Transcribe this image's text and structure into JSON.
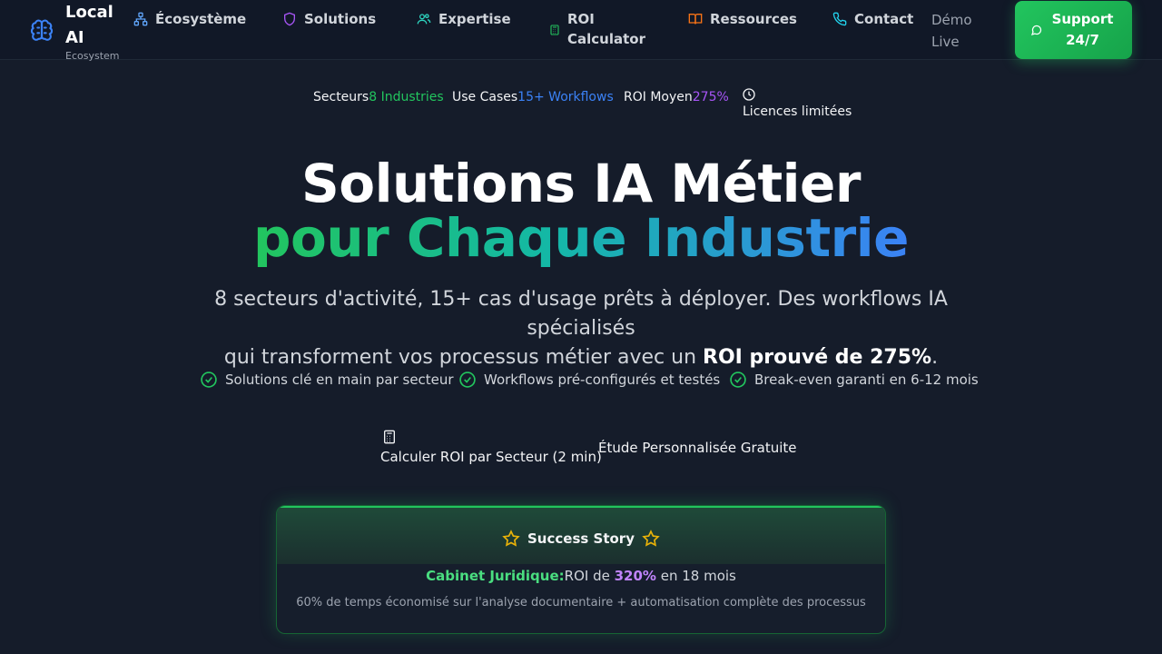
{
  "brand": {
    "name": "Local AI",
    "subtitle": "Ecosystem"
  },
  "nav": {
    "items": [
      {
        "label": "Écosystème",
        "icon": "network-icon",
        "color": "#60a5fa"
      },
      {
        "label": "Solutions",
        "icon": "shield-icon",
        "color": "#a855f7"
      },
      {
        "label": "Expertise",
        "icon": "users-icon",
        "color": "#2dd4bf"
      },
      {
        "label": "ROI Calculator",
        "icon": "calculator-icon",
        "color": "#22c55e"
      },
      {
        "label": "Ressources",
        "icon": "book-icon",
        "color": "#f97316"
      },
      {
        "label": "Contact",
        "icon": "phone-icon",
        "color": "#22d3ee"
      }
    ],
    "demo_label": "Démo Live",
    "support_label": "Support 24/7"
  },
  "stats": {
    "sectors_label": "Secteurs",
    "sectors_value": "8 Industries",
    "usecases_label": "Use Cases",
    "usecases_value": "15+ Workflows",
    "roi_label": "ROI Moyen",
    "roi_value": "275%",
    "licences": "Licences limitées"
  },
  "hero": {
    "title_line1": "Solutions IA Métier",
    "title_line2": "pour Chaque Industrie",
    "lead_line1": "8 secteurs d'activité, 15+ cas d'usage prêts à déployer. Des workflows IA spécialisés",
    "lead_line2_start": "qui transforment vos processus métier avec un ",
    "lead_line2_bold": "ROI prouvé de 275%",
    "lead_line2_end": "."
  },
  "checks": [
    "Solutions clé en main par secteur",
    "Workflows pré-configurés et testés",
    "Break-even garanti en 6-12 mois"
  ],
  "cta": {
    "primary": "Calculer ROI par Secteur (2 min)",
    "secondary": "Étude Personnalisée Gratuite"
  },
  "story": {
    "title": "Success Story",
    "client": "Cabinet Juridique:",
    "roi_prefix": "ROI de ",
    "roi_value": "320%",
    "roi_suffix": " en 18 mois",
    "description": "60% de temps économisé sur l'analyse documentaire + automatisation complète des processus"
  }
}
